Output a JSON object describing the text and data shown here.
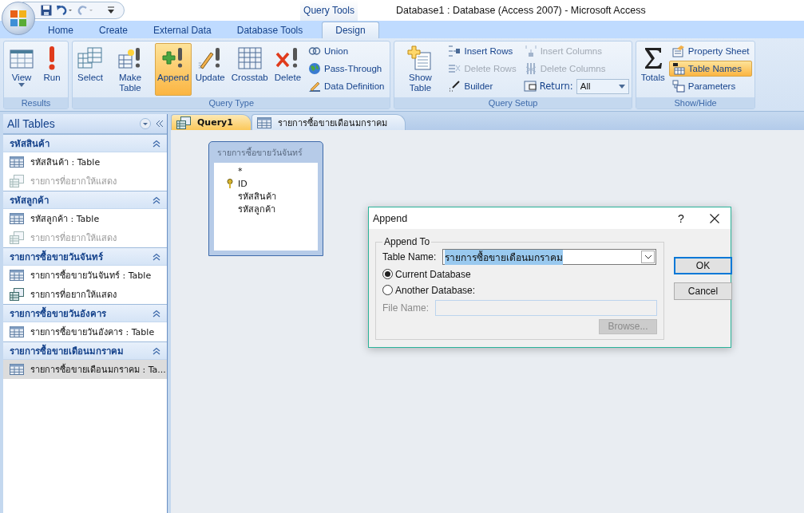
{
  "title_bar": {
    "title": "Database1 : Database (Access 2007)  -  Microsoft Access",
    "context_label": "Query Tools"
  },
  "ribbon_tabs": [
    {
      "label": "Home",
      "selected": false
    },
    {
      "label": "Create",
      "selected": false
    },
    {
      "label": "External Data",
      "selected": false
    },
    {
      "label": "Database Tools",
      "selected": false
    },
    {
      "label": "Design",
      "selected": true
    }
  ],
  "ribbon_groups": [
    {
      "label": "Results",
      "columns": [
        [
          {
            "kind": "large",
            "label": "View",
            "dropdown": true,
            "selected": false,
            "disabled": false
          }
        ],
        [
          {
            "kind": "large",
            "label": "Run",
            "selected": false,
            "disabled": false
          }
        ]
      ]
    },
    {
      "label": "Query Type",
      "columns": [
        [
          {
            "kind": "large",
            "label": "Select",
            "selected": false,
            "disabled": false
          }
        ],
        [
          {
            "kind": "large",
            "label": "Make Table",
            "selected": false,
            "disabled": false
          }
        ],
        [
          {
            "kind": "large",
            "label": "Append",
            "selected": true,
            "disabled": false
          }
        ],
        [
          {
            "kind": "large",
            "label": "Update",
            "selected": false,
            "disabled": false
          }
        ],
        [
          {
            "kind": "large",
            "label": "Crosstab",
            "selected": false,
            "disabled": false
          }
        ],
        [
          {
            "kind": "large",
            "label": "Delete",
            "selected": false,
            "disabled": false
          }
        ],
        [
          {
            "kind": "small",
            "label": "Union",
            "selected": false,
            "disabled": false
          },
          {
            "kind": "small",
            "label": "Pass-Through",
            "selected": false,
            "disabled": false
          },
          {
            "kind": "small",
            "label": "Data Definition",
            "selected": false,
            "disabled": false
          }
        ]
      ]
    },
    {
      "label": "Query Setup",
      "columns": [
        [
          {
            "kind": "large",
            "label": "Show Table",
            "selected": false,
            "disabled": false
          }
        ],
        [
          {
            "kind": "small",
            "label": "Insert Rows",
            "selected": false,
            "disabled": false
          },
          {
            "kind": "small",
            "label": "Delete Rows",
            "selected": false,
            "disabled": true
          },
          {
            "kind": "small",
            "label": "Builder",
            "selected": false,
            "disabled": false
          }
        ],
        [
          {
            "kind": "small",
            "label": "Insert Columns",
            "selected": false,
            "disabled": true
          },
          {
            "kind": "small",
            "label": "Delete Columns",
            "selected": false,
            "disabled": true
          },
          {
            "kind": "combo",
            "label": "Return:",
            "value": "All",
            "selected": false,
            "disabled": false
          }
        ]
      ]
    },
    {
      "label": "Show/Hide",
      "columns": [
        [
          {
            "kind": "large",
            "label": "Totals",
            "selected": false,
            "disabled": false
          }
        ],
        [
          {
            "kind": "small",
            "label": "Property Sheet",
            "selected": false,
            "disabled": false
          },
          {
            "kind": "small",
            "label": "Table Names",
            "selected": true,
            "disabled": false
          },
          {
            "kind": "small",
            "label": "Parameters",
            "selected": false,
            "disabled": false
          }
        ]
      ]
    }
  ],
  "nav_pane": {
    "title": "All Tables",
    "groups": [
      {
        "title": "รหัสสินค้า",
        "expanded": true,
        "items": [
          {
            "kind": "table",
            "label": "รหัสสินค้า : Table",
            "disabled": false,
            "selected": false
          },
          {
            "kind": "query",
            "label": "รายการที่อยากให้แสดง",
            "disabled": true,
            "selected": false
          }
        ]
      },
      {
        "title": "รหัสลูกค้า",
        "expanded": true,
        "items": [
          {
            "kind": "table",
            "label": "รหัสลูกค้า : Table",
            "disabled": false,
            "selected": false
          },
          {
            "kind": "query",
            "label": "รายการที่อยากให้แสดง",
            "disabled": true,
            "selected": false
          }
        ]
      },
      {
        "title": "รายการซื้อขายวันจันทร์",
        "expanded": true,
        "items": [
          {
            "kind": "table",
            "label": "รายการซื้อขายวันจันทร์ : Table",
            "disabled": false,
            "selected": false
          },
          {
            "kind": "query",
            "label": "รายการที่อยากให้แสดง",
            "disabled": false,
            "selected": false
          }
        ]
      },
      {
        "title": "รายการซื้อขายวันอังคาร",
        "expanded": true,
        "items": [
          {
            "kind": "table",
            "label": "รายการซื้อขายวันอังคาร : Table",
            "disabled": false,
            "selected": false
          }
        ]
      },
      {
        "title": "รายการซื้อขายเดือนมกราคม",
        "expanded": true,
        "items": [
          {
            "kind": "table",
            "label": "รายการซื้อขายเดือนมกราคม : Ta...",
            "disabled": false,
            "selected": true
          }
        ]
      }
    ]
  },
  "document_tabs": [
    {
      "kind": "query",
      "label": "Query1",
      "selected": true
    },
    {
      "kind": "table",
      "label": "รายการซื้อขายเดือนมกราคม",
      "selected": false
    }
  ],
  "field_list": {
    "title": "รายการซื้อขายวันจันทร์",
    "fields": [
      {
        "name": "*",
        "primary_key": false
      },
      {
        "name": "ID",
        "primary_key": true
      },
      {
        "name": "รหัสสินค้า",
        "primary_key": false
      },
      {
        "name": "รหัสลูกค้า",
        "primary_key": false
      }
    ]
  },
  "dialog": {
    "title": "Append",
    "help": "?",
    "group_label": "Append To",
    "table_name_label": "Table Name:",
    "table_name_value": "รายการซื้อขายเดือนมกราคม",
    "value_highlighted": true,
    "options": [
      {
        "label": "Current Database",
        "selected": true
      },
      {
        "label": "Another Database:",
        "selected": false
      }
    ],
    "file_name_label": "File Name:",
    "file_name_disabled": true,
    "browse": {
      "label": "Browse...",
      "disabled": true
    },
    "buttons": [
      {
        "label": "OK",
        "default": true
      },
      {
        "label": "Cancel",
        "default": false
      }
    ]
  }
}
